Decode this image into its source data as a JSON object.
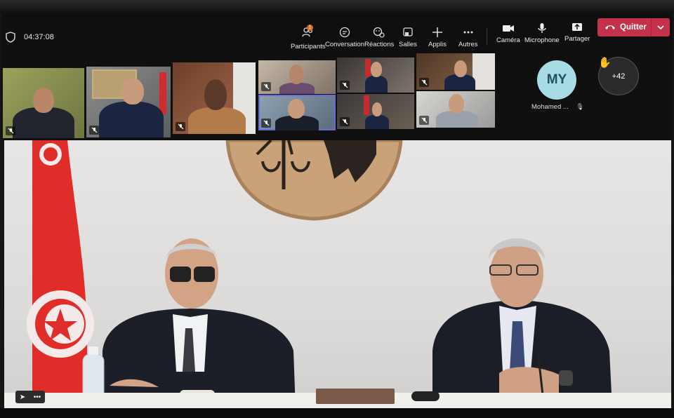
{
  "meeting": {
    "timer": "04:37:08",
    "toolbar": {
      "participants": "Participants",
      "participants_badge": "1",
      "conversation": "Conversation",
      "reactions": "Réactions",
      "rooms": "Salles",
      "apps": "Applis",
      "more": "Autres",
      "camera": "Caméra",
      "microphone": "Microphone",
      "share": "Partager",
      "leave": "Quitter"
    },
    "avatar": {
      "initials": "MY",
      "name": "Mohamed ..."
    },
    "overflow_count": "+42",
    "hand_icon": "✋",
    "colors": {
      "toolbar_bg": "#0f0f10",
      "leave_red": "#c4314b",
      "selected_tile": "#6b69d6",
      "avatar_bg": "#a8dce4"
    }
  }
}
